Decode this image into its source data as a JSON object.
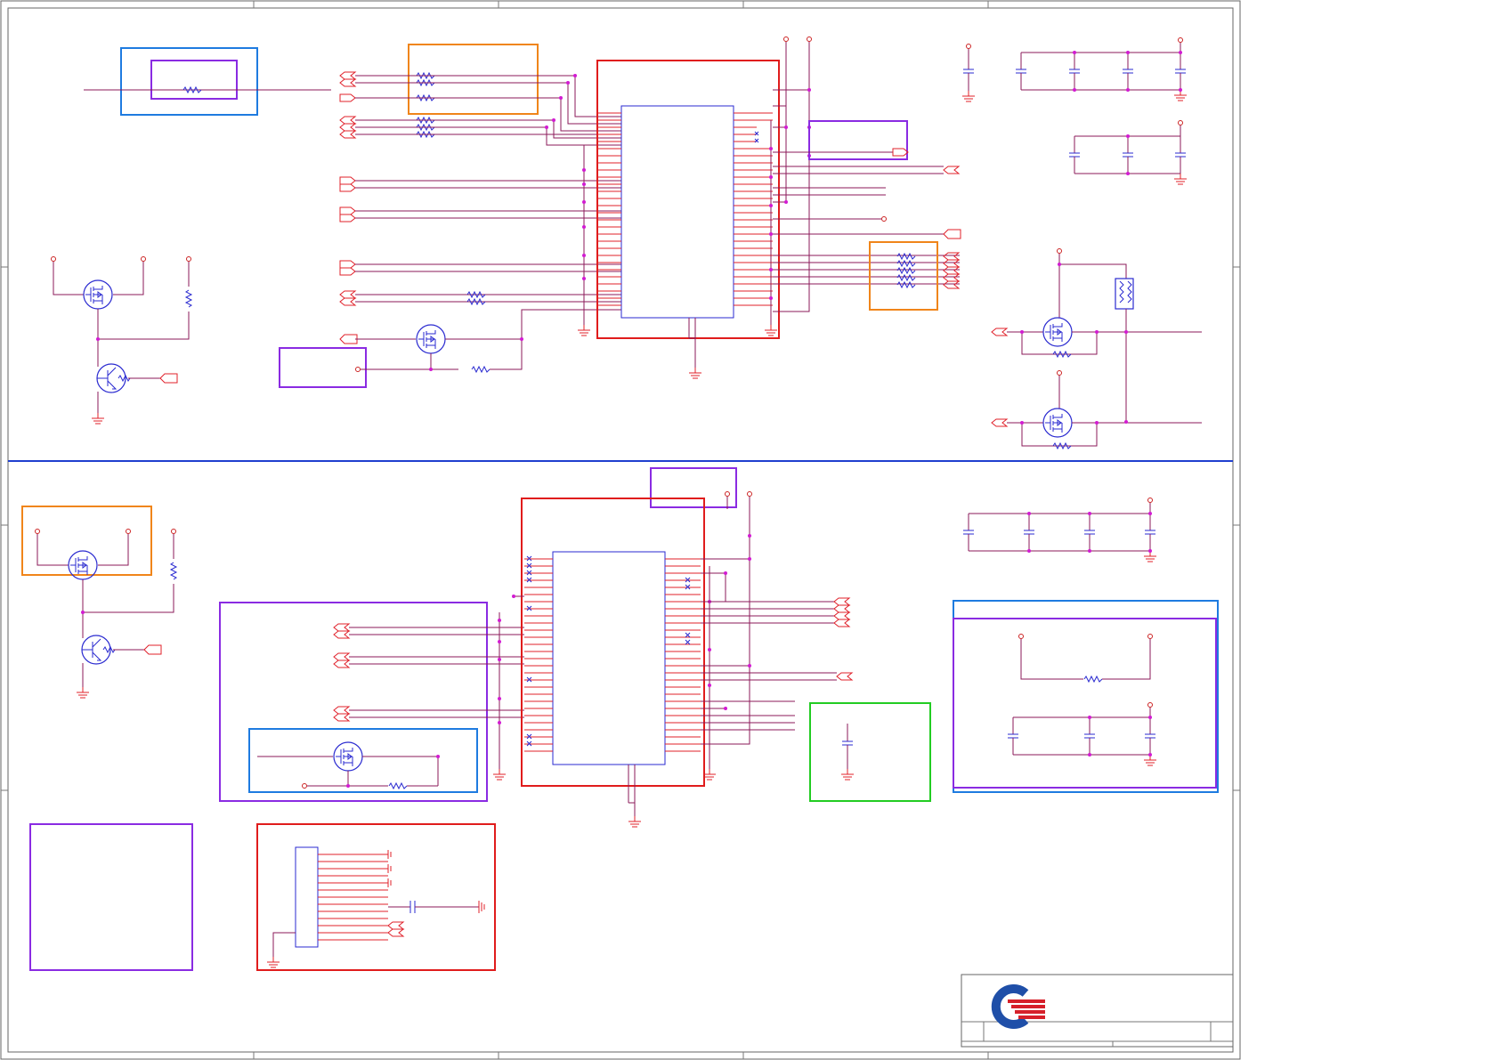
{
  "sheet": {
    "title": ""
  },
  "palette": {
    "wire": "#8b1a5a",
    "pin": "#e0202a",
    "part": "#2a2ad0",
    "junction": "#d21bd2",
    "block_blue": "#1e7be0",
    "block_purple": "#8a2be2",
    "block_orange": "#f0851a",
    "block_red": "#e01c1c",
    "block_green": "#22cc22",
    "bus_divider": "#1f3fcf"
  },
  "logo": {
    "ring_color": "#1f4fa8",
    "stripe_color": "#d6202a"
  }
}
